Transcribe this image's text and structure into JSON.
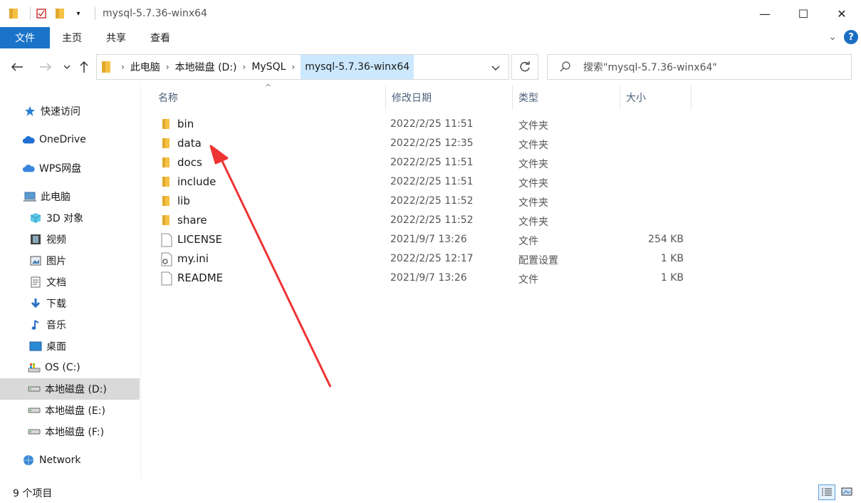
{
  "window": {
    "title": "mysql-5.7.36-winx64",
    "minimize_glyph": "—",
    "maximize_glyph": "☐",
    "close_glyph": "✕"
  },
  "ribbon": {
    "tabs": [
      "文件",
      "主页",
      "共享",
      "查看"
    ],
    "help_glyph": "?"
  },
  "address": {
    "crumbs": [
      "此电脑",
      "本地磁盘 (D:)",
      "MySQL",
      "mysql-5.7.36-winx64"
    ],
    "search_placeholder": "搜索\"mysql-5.7.36-winx64\""
  },
  "columns": {
    "name": "名称",
    "date": "修改日期",
    "type": "类型",
    "size": "大小"
  },
  "files": [
    {
      "name": "bin",
      "date": "2022/2/25 11:51",
      "type": "文件夹",
      "size": "",
      "icon": "folder-icon"
    },
    {
      "name": "data",
      "date": "2022/2/25 12:35",
      "type": "文件夹",
      "size": "",
      "icon": "folder-icon"
    },
    {
      "name": "docs",
      "date": "2022/2/25 11:51",
      "type": "文件夹",
      "size": "",
      "icon": "folder-icon"
    },
    {
      "name": "include",
      "date": "2022/2/25 11:51",
      "type": "文件夹",
      "size": "",
      "icon": "folder-icon"
    },
    {
      "name": "lib",
      "date": "2022/2/25 11:52",
      "type": "文件夹",
      "size": "",
      "icon": "folder-icon"
    },
    {
      "name": "share",
      "date": "2022/2/25 11:52",
      "type": "文件夹",
      "size": "",
      "icon": "folder-icon"
    },
    {
      "name": "LICENSE",
      "date": "2021/9/7 13:26",
      "type": "文件",
      "size": "254 KB",
      "icon": "file-icon"
    },
    {
      "name": "my.ini",
      "date": "2022/2/25 12:17",
      "type": "配置设置",
      "size": "1 KB",
      "icon": "settings-file-icon"
    },
    {
      "name": "README",
      "date": "2021/9/7 13:26",
      "type": "文件",
      "size": "1 KB",
      "icon": "file-icon"
    }
  ],
  "nav": [
    {
      "label": "快速访问",
      "icon": "star-icon",
      "level": 0
    },
    {
      "label": "OneDrive",
      "icon": "cloud-icon",
      "level": 0
    },
    {
      "label": "WPS网盘",
      "icon": "wps-cloud-icon",
      "level": 0
    },
    {
      "label": "此电脑",
      "icon": "computer-icon",
      "level": 0
    },
    {
      "label": "3D 对象",
      "icon": "cube-icon",
      "level": 1
    },
    {
      "label": "视频",
      "icon": "video-icon",
      "level": 1
    },
    {
      "label": "图片",
      "icon": "picture-icon",
      "level": 1
    },
    {
      "label": "文档",
      "icon": "document-icon",
      "level": 1
    },
    {
      "label": "下载",
      "icon": "download-icon",
      "level": 1
    },
    {
      "label": "音乐",
      "icon": "music-icon",
      "level": 1
    },
    {
      "label": "桌面",
      "icon": "desktop-icon",
      "level": 1
    },
    {
      "label": "OS (C:)",
      "icon": "drive-c-icon",
      "level": 1
    },
    {
      "label": "本地磁盘 (D:)",
      "icon": "drive-icon",
      "level": 1,
      "selected": true
    },
    {
      "label": "本地磁盘 (E:)",
      "icon": "drive-icon",
      "level": 1
    },
    {
      "label": "本地磁盘 (F:)",
      "icon": "drive-icon",
      "level": 1
    },
    {
      "label": "Network",
      "icon": "network-icon",
      "level": 0
    }
  ],
  "status": {
    "item_count": "9 个项目"
  },
  "colors": {
    "accent": "#1a73c8",
    "selected_crumb": "#cce8ff",
    "annotation_arrow": "#ee3333",
    "folder": "#f5c144"
  }
}
